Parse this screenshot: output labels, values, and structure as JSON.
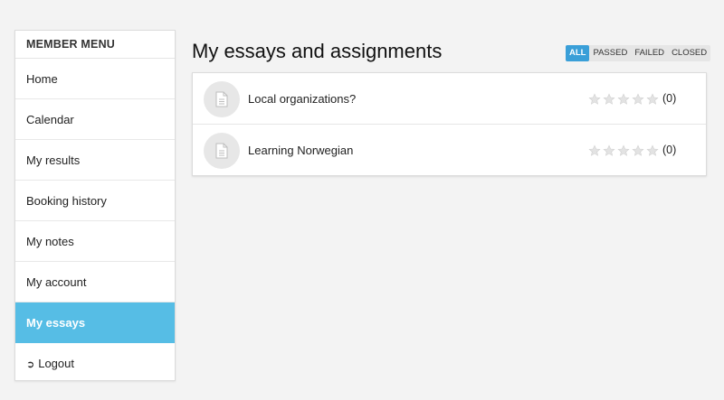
{
  "sidebar": {
    "header": "MEMBER MENU",
    "items": [
      {
        "label": "Home"
      },
      {
        "label": "Calendar"
      },
      {
        "label": "My results"
      },
      {
        "label": "Booking history"
      },
      {
        "label": "My notes"
      },
      {
        "label": "My account"
      },
      {
        "label": "My essays",
        "active": true
      },
      {
        "label": "Logout"
      }
    ]
  },
  "main": {
    "title": "My essays and assignments",
    "filters": [
      "ALL",
      "PASSED",
      "FAILED",
      "CLOSED"
    ],
    "active_filter": "ALL",
    "essays": [
      {
        "title": "Local organizations?",
        "rating": 0,
        "count": "(0)"
      },
      {
        "title": "Learning Norwegian",
        "rating": 0,
        "count": "(0)"
      }
    ]
  },
  "colors": {
    "accent": "#56bde5",
    "filter_active": "#3a9fd8",
    "star": "#d9d9d9"
  }
}
